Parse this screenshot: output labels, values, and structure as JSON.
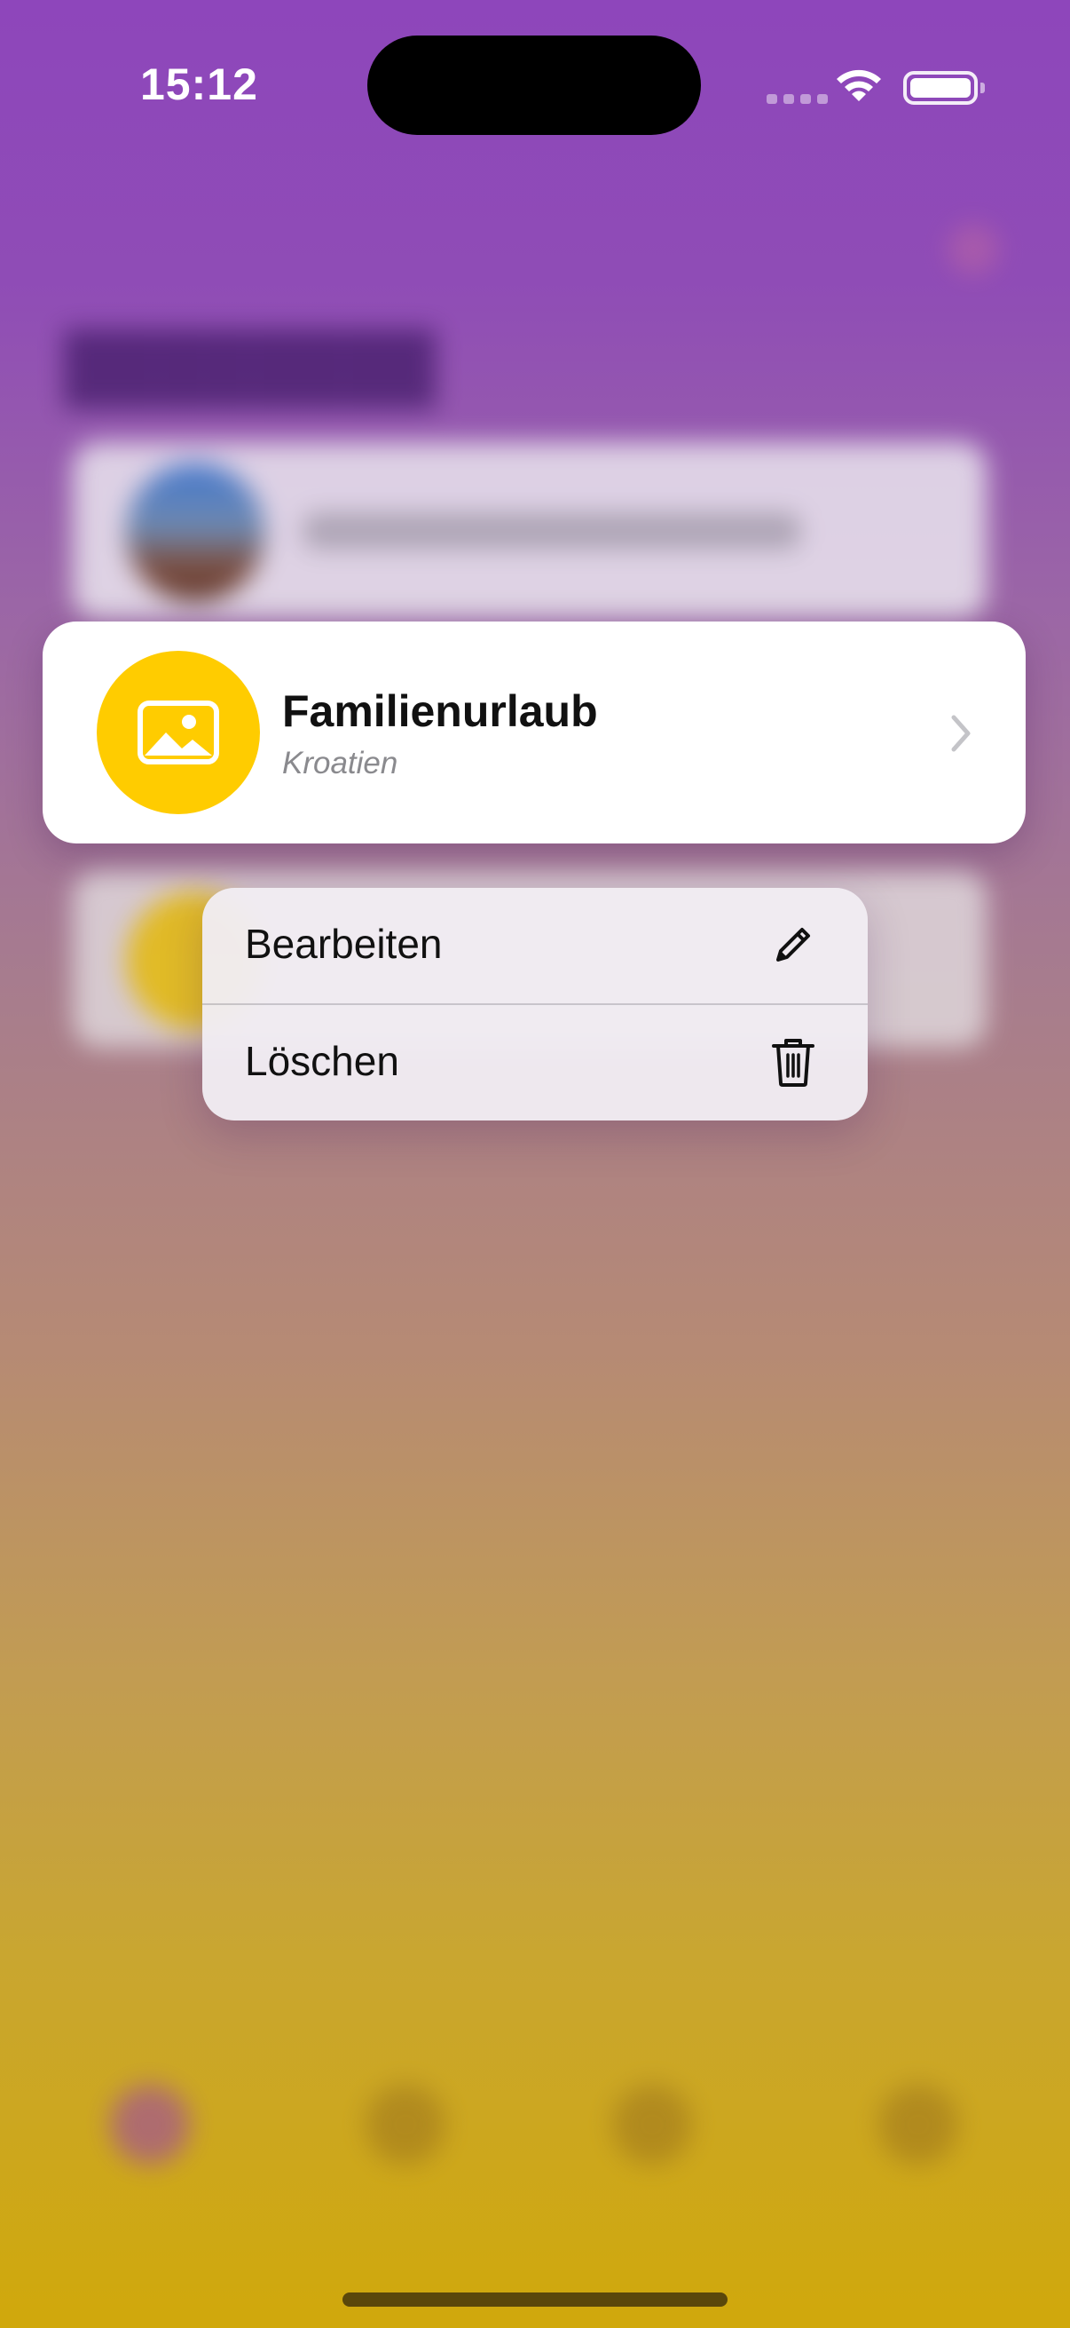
{
  "status_bar": {
    "time": "15:12"
  },
  "card": {
    "title": "Familienurlaub",
    "subtitle": "Kroatien",
    "avatar_color": "#ffcc00",
    "avatar_icon": "photo-icon",
    "accessory_icon": "chevron-right-icon"
  },
  "context_menu": {
    "items": [
      {
        "label": "Bearbeiten",
        "icon": "pencil-icon"
      },
      {
        "label": "Löschen",
        "icon": "trash-icon"
      }
    ]
  },
  "colors": {
    "background_top": "#8e46bb",
    "background_bottom": "#d0a80b",
    "card_background": "#ffffff",
    "menu_background": "#f0ecf2"
  }
}
